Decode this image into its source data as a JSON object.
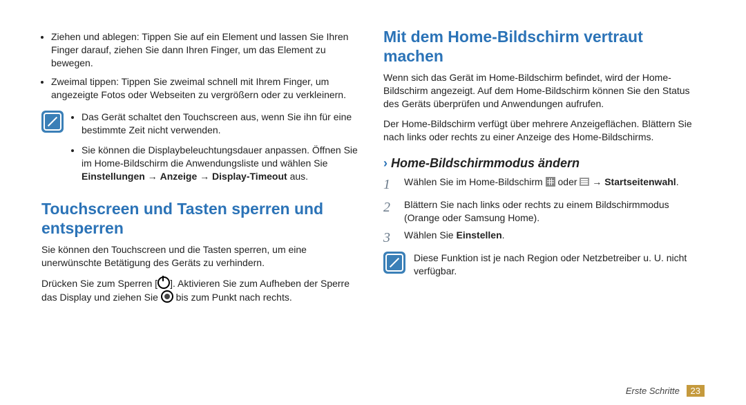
{
  "left": {
    "bullets": [
      "Ziehen und ablegen: Tippen Sie auf ein Element und lassen Sie Ihren Finger darauf, ziehen Sie dann Ihren Finger, um das Element zu bewegen.",
      "Zweimal tippen: Tippen Sie zweimal schnell mit Ihrem Finger, um angezeigte Fotos oder Webseiten zu vergrößern oder zu verkleinern."
    ],
    "note": {
      "items": [
        {
          "text": "Das Gerät schaltet den Touchscreen aus, wenn Sie ihn für eine bestimmte Zeit nicht verwenden."
        },
        {
          "text_pre": "Sie können die Displaybeleuchtungsdauer anpassen. Öffnen Sie im Home-Bildschirm die Anwendungsliste und wählen Sie ",
          "bold1": "Einstellungen",
          "arrow1": " → ",
          "bold2": "Anzeige",
          "arrow2": " → ",
          "bold3": "Display-Timeout",
          "text_post": " aus."
        }
      ]
    },
    "h1": "Touchscreen und Tasten sperren und entsperren",
    "p1": "Sie können den Touchscreen und die Tasten sperren, um eine unerwünschte Betätigung des Geräts zu verhindern.",
    "p2_pre": "Drücken Sie zum Sperren [",
    "p2_mid": "]. Aktivieren Sie zum Aufheben der Sperre das Display und ziehen Sie ",
    "p2_post": " bis zum Punkt nach rechts."
  },
  "right": {
    "h1": "Mit dem Home-Bildschirm vertraut machen",
    "p1": "Wenn sich das Gerät im Home-Bildschirm befindet, wird der Home-Bildschirm angezeigt. Auf dem Home-Bildschirm können Sie den Status des Geräts überprüfen und Anwendungen aufrufen.",
    "p2": "Der Home-Bildschirm verfügt über mehrere Anzeigeflächen. Blättern Sie nach links oder rechts zu einer Anzeige des Home-Bildschirms.",
    "h2_chev": "›",
    "h2": "Home-Bildschirmmodus ändern",
    "steps": {
      "s1_num": "1",
      "s1_pre": "Wählen Sie im Home-Bildschirm ",
      "s1_mid": " oder ",
      "s1_arrow": " → ",
      "s1_bold": "Startseitenwahl",
      "s1_post": ".",
      "s2_num": "2",
      "s2": "Blättern Sie nach links oder rechts zu einem Bildschirmmodus (Orange oder Samsung Home).",
      "s3_num": "3",
      "s3_pre": "Wählen Sie ",
      "s3_bold": "Einstellen",
      "s3_post": "."
    },
    "note2": "Diese Funktion ist je nach Region oder Netzbetreiber u. U. nicht verfügbar."
  },
  "footer": {
    "section": "Erste Schritte",
    "page": "23"
  }
}
